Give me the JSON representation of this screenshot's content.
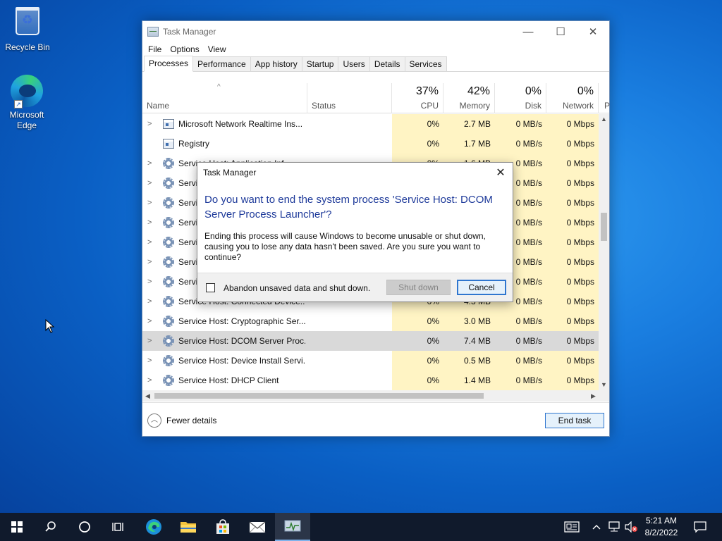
{
  "desktop": {
    "icons": [
      {
        "label": "Recycle Bin"
      },
      {
        "label": "Microsoft Edge"
      }
    ]
  },
  "window": {
    "title": "Task Manager",
    "controls": {
      "minimize": "—",
      "maximize": "☐",
      "close": "✕"
    },
    "menu": [
      "File",
      "Options",
      "View"
    ],
    "tabs": [
      "Processes",
      "Performance",
      "App history",
      "Startup",
      "Users",
      "Details",
      "Services"
    ],
    "active_tab": "Processes",
    "columns": {
      "name": "Name",
      "status": "Status",
      "cpu": {
        "pct": "37%",
        "label": "CPU"
      },
      "memory": {
        "pct": "42%",
        "label": "Memory"
      },
      "disk": {
        "pct": "0%",
        "label": "Disk"
      },
      "network": {
        "pct": "0%",
        "label": "Network"
      },
      "power": "P"
    },
    "rows": [
      {
        "expand": ">",
        "icon": "window",
        "name": "Microsoft Network Realtime Ins...",
        "cpu": "0%",
        "memory": "2.7 MB",
        "disk": "0 MB/s",
        "network": "0 Mbps"
      },
      {
        "expand": "",
        "icon": "window",
        "name": "Registry",
        "cpu": "0%",
        "memory": "1.7 MB",
        "disk": "0 MB/s",
        "network": "0 Mbps"
      },
      {
        "expand": ">",
        "icon": "gear",
        "name": "Service Host: Application Inf...",
        "cpu": "0%",
        "memory": "1.6 MB",
        "disk": "0 MB/s",
        "network": "0 Mbps"
      },
      {
        "expand": ">",
        "icon": "gear",
        "name": "Service",
        "cpu": "",
        "memory": "",
        "disk": "0 MB/s",
        "network": "0 Mbps"
      },
      {
        "expand": ">",
        "icon": "gear",
        "name": "Service",
        "cpu": "",
        "memory": "",
        "disk": "0 MB/s",
        "network": "0 Mbps"
      },
      {
        "expand": ">",
        "icon": "gear",
        "name": "Service",
        "cpu": "",
        "memory": "",
        "disk": "0 MB/s",
        "network": "0 Mbps"
      },
      {
        "expand": ">",
        "icon": "gear",
        "name": "Service",
        "cpu": "",
        "memory": "",
        "disk": "0 MB/s",
        "network": "0 Mbps"
      },
      {
        "expand": ">",
        "icon": "gear",
        "name": "Service",
        "cpu": "",
        "memory": "",
        "disk": "0 MB/s",
        "network": "0 Mbps"
      },
      {
        "expand": ">",
        "icon": "gear",
        "name": "Service",
        "cpu": "",
        "memory": "",
        "disk": "0 MB/s",
        "network": "0 Mbps"
      },
      {
        "expand": ">",
        "icon": "gear",
        "name": "Service Host: Connected Device...",
        "cpu": "0%",
        "memory": "4.3 MB",
        "disk": "0 MB/s",
        "network": "0 Mbps"
      },
      {
        "expand": ">",
        "icon": "gear",
        "name": "Service Host: Cryptographic Ser...",
        "cpu": "0%",
        "memory": "3.0 MB",
        "disk": "0 MB/s",
        "network": "0 Mbps"
      },
      {
        "expand": ">",
        "icon": "gear",
        "name": "Service Host: DCOM Server Proc...",
        "cpu": "0%",
        "memory": "7.4 MB",
        "disk": "0 MB/s",
        "network": "0 Mbps",
        "selected": true
      },
      {
        "expand": ">",
        "icon": "gear",
        "name": "Service Host: Device Install Servi...",
        "cpu": "0%",
        "memory": "0.5 MB",
        "disk": "0 MB/s",
        "network": "0 Mbps"
      },
      {
        "expand": ">",
        "icon": "gear",
        "name": "Service Host: DHCP Client",
        "cpu": "0%",
        "memory": "1.4 MB",
        "disk": "0 MB/s",
        "network": "0 Mbps"
      }
    ],
    "footer": {
      "fewer_details": "Fewer details",
      "end_task": "End task"
    }
  },
  "dialog": {
    "title": "Task Manager",
    "close": "✕",
    "main_instruction": "Do you want to end the system process 'Service Host: DCOM Server Process Launcher'?",
    "content": "Ending this process will cause Windows to become unusable or shut down, causing you to lose any data hasn't been saved. Are you sure you want to continue?",
    "checkbox_label": "Abandon unsaved data and shut down.",
    "shutdown_button": "Shut down",
    "cancel_button": "Cancel"
  },
  "taskbar": {
    "clock_time": "5:21 AM",
    "clock_date": "8/2/2022"
  },
  "colors": {
    "heat_column": "#fff4c4",
    "selected_row": "#d9d9d9",
    "accent": "#2f76cf",
    "dialog_heading": "#1e3a9a",
    "taskbar": "#101a2c"
  }
}
